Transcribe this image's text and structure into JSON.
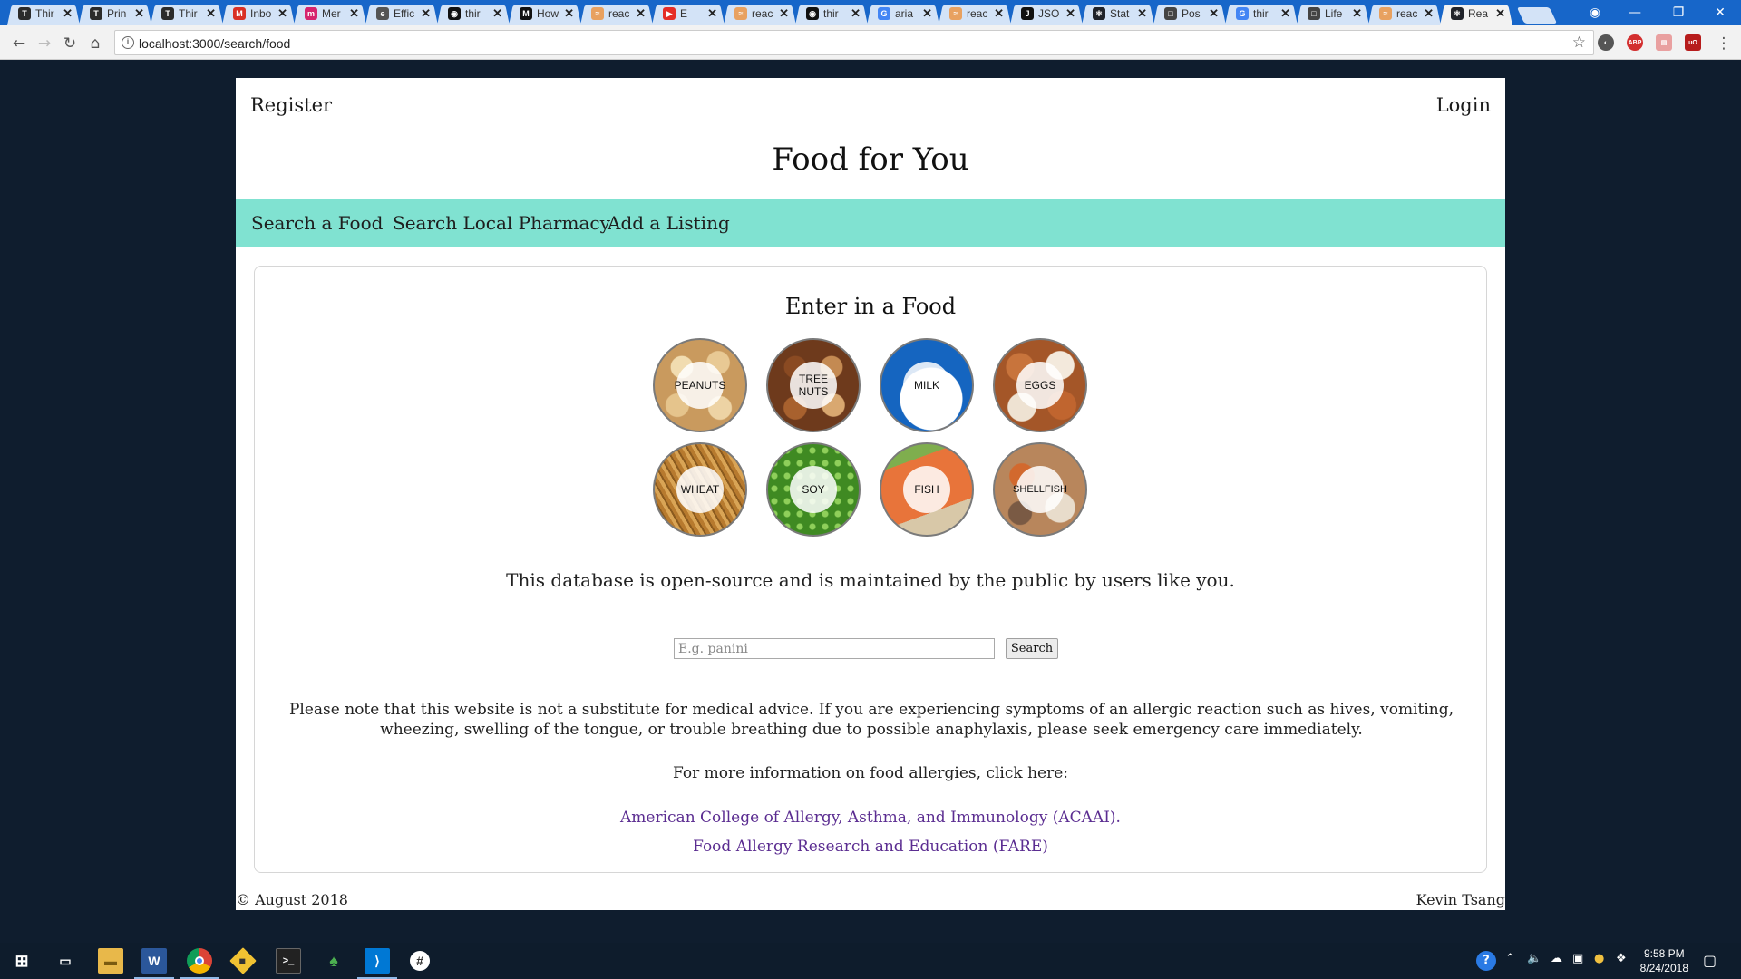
{
  "browser": {
    "tabs": [
      {
        "title": "Thir",
        "icon": "T",
        "color": "#2b2b2b"
      },
      {
        "title": "Prin",
        "icon": "T",
        "color": "#2b2b2b"
      },
      {
        "title": "Thir",
        "icon": "T",
        "color": "#2b2b2b"
      },
      {
        "title": "Inbo",
        "icon": "M",
        "color": "#d93025"
      },
      {
        "title": "Mer",
        "icon": "m",
        "color": "#d6246e"
      },
      {
        "title": "Effic",
        "icon": "e",
        "color": "#555555"
      },
      {
        "title": "thir",
        "icon": "◉",
        "color": "#111111"
      },
      {
        "title": "How",
        "icon": "M",
        "color": "#111111"
      },
      {
        "title": "reac",
        "icon": "≈",
        "color": "#e8a160"
      },
      {
        "title": "E",
        "icon": "▶",
        "color": "#e52d27"
      },
      {
        "title": "reac",
        "icon": "≈",
        "color": "#e8a160"
      },
      {
        "title": "thir",
        "icon": "◉",
        "color": "#111111"
      },
      {
        "title": "aria",
        "icon": "G",
        "color": "#4285f4"
      },
      {
        "title": "reac",
        "icon": "≈",
        "color": "#e8a160"
      },
      {
        "title": "JSO",
        "icon": "J",
        "color": "#111111"
      },
      {
        "title": "Stat",
        "icon": "⚛",
        "color": "#20232a"
      },
      {
        "title": "Pos",
        "icon": "□",
        "color": "#444444"
      },
      {
        "title": "thir",
        "icon": "G",
        "color": "#4285f4"
      },
      {
        "title": "Life",
        "icon": "□",
        "color": "#444444"
      },
      {
        "title": "reac",
        "icon": "≈",
        "color": "#e8a160"
      },
      {
        "title": "Rea",
        "icon": "⚛",
        "color": "#20232a",
        "active": true
      }
    ],
    "url": "localhost:3000/search/food"
  },
  "site": {
    "register": "Register",
    "login": "Login",
    "title": "Food for You",
    "nav": [
      "Search a Food",
      "Search Local Pharmacy",
      "Add a Listing"
    ],
    "heading": "Enter in a Food",
    "foods": [
      {
        "label": "PEANUTS"
      },
      {
        "label": "TREE\nNUTS"
      },
      {
        "label": "MILK"
      },
      {
        "label": "EGGS"
      },
      {
        "label": "WHEAT"
      },
      {
        "label": "SOY"
      },
      {
        "label": "FISH"
      },
      {
        "label": "SHELLFISH"
      }
    ],
    "tagline": "This database is open-source and is maintained by the public by users like you.",
    "search": {
      "placeholder": "E.g. panini",
      "button": "Search"
    },
    "disclaimer": "Please note that this website is not a substitute for medical advice. If you are experiencing symptoms of an allergic reaction such as hives, vomiting, wheezing, swelling of the tongue, or trouble breathing due to possible anaphylaxis, please seek emergency care immediately.",
    "more_info": "For more information on food allergies, click here:",
    "links": [
      "American College of Allergy, Asthma, and Immunology (ACAAI).",
      "Food Allergy Research and Education (FARE)"
    ],
    "footer_left": "© August 2018",
    "footer_right": "Kevin Tsang"
  },
  "taskbar": {
    "time": "9:58 PM",
    "date": "8/24/2018"
  },
  "colors": {
    "navbar": "#80e2d1",
    "link": "#5b2d91",
    "page_bg": "#0f1d2e",
    "tabstrip": "#1766c9"
  }
}
